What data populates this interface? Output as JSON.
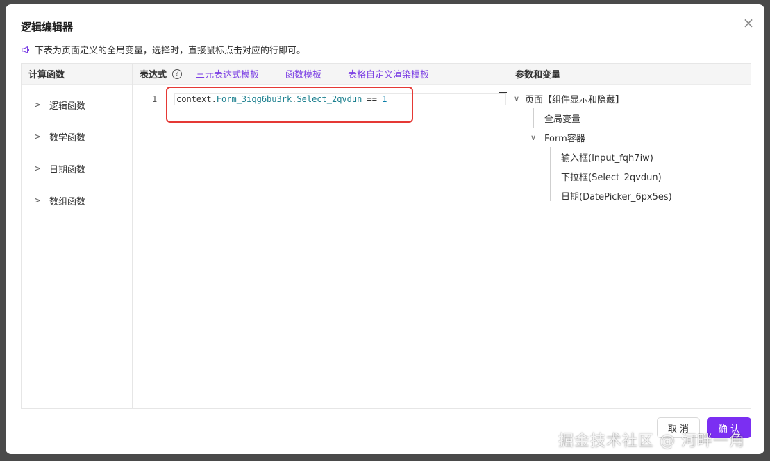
{
  "dialog": {
    "title": "逻辑编辑器",
    "close_label": "×",
    "notice": "下表为页面定义的全局变量，选择时，直接鼠标点击对应的行即可。"
  },
  "left_panel": {
    "header": "计算函数",
    "items": [
      {
        "label": "逻辑函数"
      },
      {
        "label": "数学函数"
      },
      {
        "label": "日期函数"
      },
      {
        "label": "数组函数"
      }
    ]
  },
  "mid_panel": {
    "header": "表达式",
    "help_label": "?",
    "links": [
      "三元表达式模板",
      "函数模板",
      "表格自定义渲染模板"
    ],
    "editor": {
      "line_number": "1",
      "tokens": [
        {
          "text": "context.",
          "kind": "plain"
        },
        {
          "text": "Form_3iqg6bu3rk",
          "kind": "prop"
        },
        {
          "text": ".",
          "kind": "plain"
        },
        {
          "text": "Select_2qvdun",
          "kind": "prop"
        },
        {
          "text": " == ",
          "kind": "plain"
        },
        {
          "text": "1",
          "kind": "num"
        }
      ]
    }
  },
  "right_panel": {
    "header": "参数和变量",
    "tree": {
      "root": "页面【组件显示和隐藏】",
      "global": "全局变量",
      "form": "Form容器",
      "fields": [
        "输入框(Input_fqh7iw)",
        "下拉框(Select_2qvdun)",
        "日期(DatePicker_6px5es)"
      ]
    }
  },
  "footer": {
    "cancel_label": "取 消",
    "ok_label": "确 认"
  },
  "watermark": "掘金技术社区 @ 河畔一角",
  "colors": {
    "accent": "#7b2ff2",
    "link": "#7b3fe4",
    "highlight": "#e53935"
  }
}
